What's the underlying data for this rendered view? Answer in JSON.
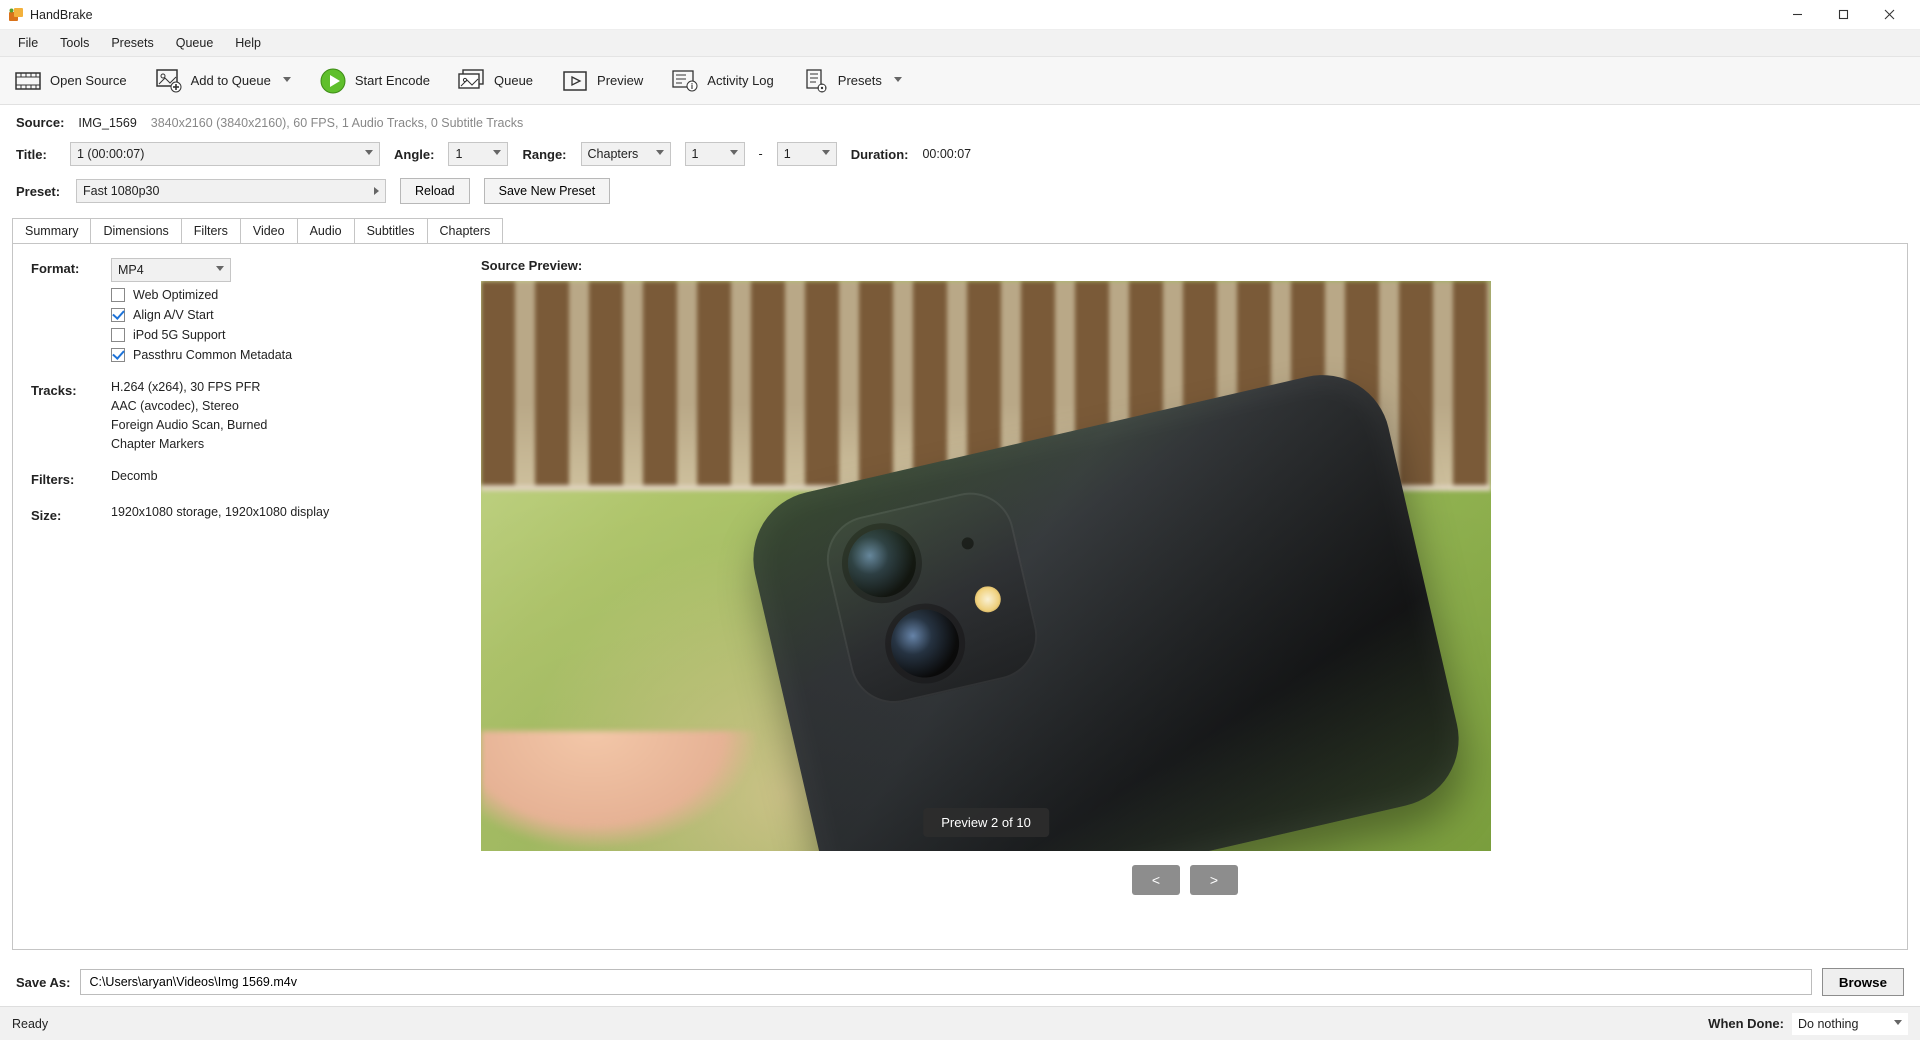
{
  "window": {
    "title": "HandBrake",
    "controls": {
      "min": "minimize",
      "max": "maximize",
      "close": "close"
    }
  },
  "menubar": [
    "File",
    "Tools",
    "Presets",
    "Queue",
    "Help"
  ],
  "toolbar": {
    "open_source": "Open Source",
    "add_to_queue": "Add to Queue",
    "start_encode": "Start Encode",
    "queue": "Queue",
    "preview": "Preview",
    "activity_log": "Activity Log",
    "presets": "Presets"
  },
  "source": {
    "label": "Source:",
    "name": "IMG_1569",
    "info": "3840x2160 (3840x2160), 60 FPS, 1 Audio Tracks, 0 Subtitle Tracks"
  },
  "title_row": {
    "title_label": "Title:",
    "title_value": "1  (00:00:07)",
    "angle_label": "Angle:",
    "angle_value": "1",
    "range_label": "Range:",
    "range_mode": "Chapters",
    "range_from": "1",
    "range_to_sep": "-",
    "range_to": "1",
    "duration_label": "Duration:",
    "duration_value": "00:00:07"
  },
  "preset_row": {
    "label": "Preset:",
    "value": "Fast 1080p30",
    "reload": "Reload",
    "save_new": "Save New Preset"
  },
  "tabs": [
    "Summary",
    "Dimensions",
    "Filters",
    "Video",
    "Audio",
    "Subtitles",
    "Chapters"
  ],
  "active_tab": "Summary",
  "summary": {
    "format_label": "Format:",
    "format_value": "MP4",
    "opts": {
      "web_optimized": {
        "label": "Web Optimized",
        "checked": false
      },
      "align_av": {
        "label": "Align A/V Start",
        "checked": true
      },
      "ipod": {
        "label": "iPod 5G Support",
        "checked": false
      },
      "passthru": {
        "label": "Passthru Common Metadata",
        "checked": true
      }
    },
    "tracks_label": "Tracks:",
    "tracks": [
      "H.264 (x264), 30 FPS PFR",
      "AAC (avcodec), Stereo",
      "Foreign Audio Scan, Burned",
      "Chapter Markers"
    ],
    "filters_label": "Filters:",
    "filters_value": "Decomb",
    "size_label": "Size:",
    "size_value": "1920x1080 storage, 1920x1080 display"
  },
  "preview": {
    "heading": "Source Preview:",
    "overlay": "Preview 2 of 10",
    "prev": "<",
    "next": ">"
  },
  "save": {
    "label": "Save As:",
    "path": "C:\\Users\\aryan\\Videos\\Img 1569.m4v",
    "browse": "Browse"
  },
  "status": {
    "left": "Ready",
    "when_done_label": "When Done:",
    "when_done_value": "Do nothing"
  }
}
